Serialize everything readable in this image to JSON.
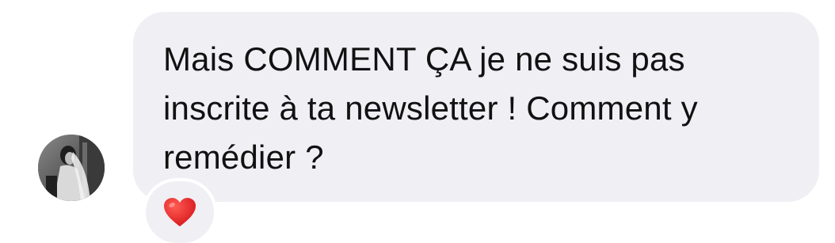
{
  "message": {
    "text": "Mais COMMENT ÇA je ne suis pas inscrite à ta newsletter ! Comment y remédier ?"
  },
  "reaction": {
    "icon": "red-heart-icon",
    "color": "#e0201f"
  },
  "sender": {
    "avatar_icon": "profile-photo"
  },
  "colors": {
    "bubble": "#efeff4",
    "text": "#111111"
  }
}
